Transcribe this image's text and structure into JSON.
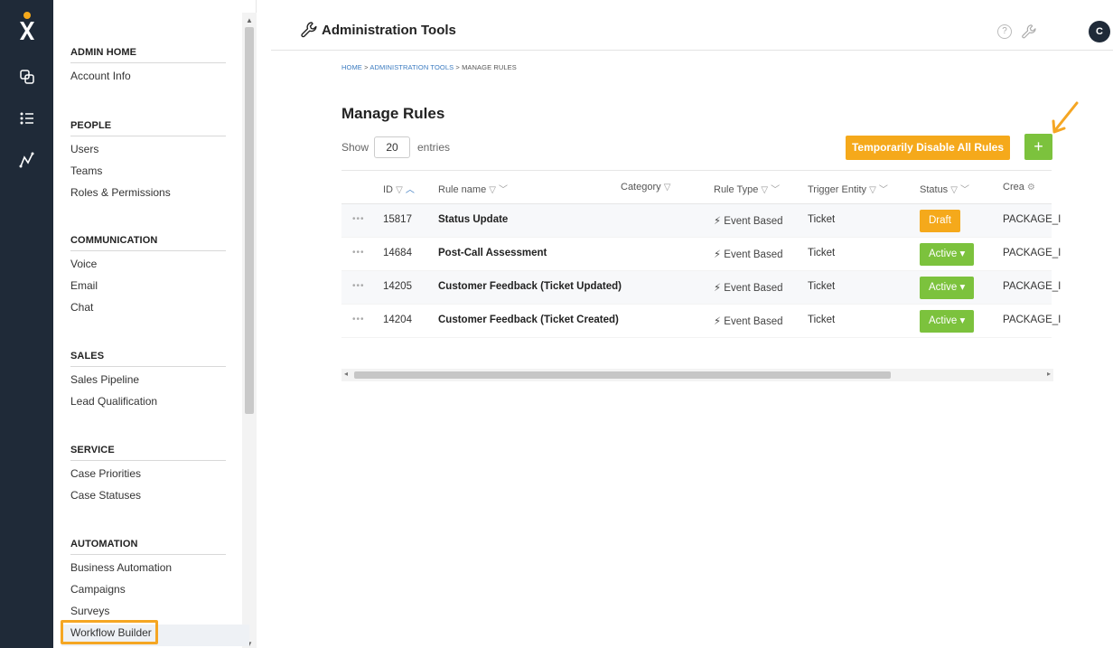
{
  "app": {
    "title": "Administration Tools",
    "avatar_initial": "C",
    "help_glyph": "?"
  },
  "breadcrumb": {
    "home": "HOME",
    "sep1": " > ",
    "admin": "ADMINISTRATION TOOLS",
    "sep2": " > ",
    "current": "MANAGE RULES"
  },
  "page": {
    "title": "Manage Rules"
  },
  "controls": {
    "show_label": "Show",
    "entries_value": "20",
    "entries_label": "entries",
    "disable_all_label": "Temporarily Disable All Rules",
    "add_label": "+"
  },
  "sidebar": {
    "sections": [
      {
        "header": "ADMIN HOME",
        "items": [
          "Account Info"
        ]
      },
      {
        "header": "PEOPLE",
        "items": [
          "Users",
          "Teams",
          "Roles & Permissions"
        ]
      },
      {
        "header": "COMMUNICATION",
        "items": [
          "Voice",
          "Email",
          "Chat"
        ]
      },
      {
        "header": "SALES",
        "items": [
          "Sales Pipeline",
          "Lead Qualification"
        ]
      },
      {
        "header": "SERVICE",
        "items": [
          "Case Priorities",
          "Case Statuses"
        ]
      },
      {
        "header": "AUTOMATION",
        "items": [
          "Business Automation",
          "Campaigns",
          "Surveys",
          "Workflow Builder"
        ]
      }
    ]
  },
  "table": {
    "columns": {
      "id": "ID",
      "rule_name": "Rule name",
      "category": "Category",
      "rule_type": "Rule Type",
      "trigger_entity": "Trigger Entity",
      "status": "Status",
      "created": "Crea"
    },
    "rows": [
      {
        "dots": "•••",
        "id": "15817",
        "name": "Status Update",
        "type": "Event Based",
        "entity": "Ticket",
        "status": "Draft",
        "created": "PACKAGE_I"
      },
      {
        "dots": "•••",
        "id": "14684",
        "name": "Post-Call Assessment",
        "type": "Event Based",
        "entity": "Ticket",
        "status": "Active",
        "created": "PACKAGE_I"
      },
      {
        "dots": "•••",
        "id": "14205",
        "name": "Customer Feedback (Ticket Updated)",
        "type": "Event Based",
        "entity": "Ticket",
        "status": "Active",
        "created": "PACKAGE_I"
      },
      {
        "dots": "•••",
        "id": "14204",
        "name": "Customer Feedback (Ticket Created)",
        "type": "Event Based",
        "entity": "Ticket",
        "status": "Active",
        "created": "PACKAGE_I"
      }
    ]
  },
  "colors": {
    "rail": "#1f2a38",
    "orange": "#f5a91b",
    "green": "#7cc23d",
    "link": "#3b7bc0",
    "highlight": "#f5a623"
  }
}
